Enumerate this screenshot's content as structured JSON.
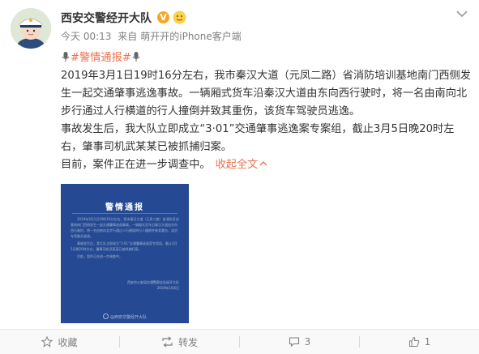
{
  "post": {
    "author": "西安交警经开大队",
    "timestamp": "今天 00:13",
    "source_prefix": "来自",
    "source_client": "萌开开的iPhone客户端",
    "hashtag": "#警情通报#",
    "paragraphs": [
      "2019年3月1日19时16分左右，我市秦汉大道（元凤二路）省消防培训基地南门西侧发生一起交通肇事逃逸事故。一辆厢式货车沿秦汉大道由东向西行驶时，将一名由南向北步行通过人行横道的行人撞倒并致其重伤，该货车驾驶员逃逸。",
      "事故发生后，我大队立即成立“3·01”交通肇事逃逸案专案组，截止3月5日晚20时左右，肇事司机武某某已被抓捕归案。",
      "目前，案件正在进一步调查中。"
    ],
    "collapse_label": "收起全文"
  },
  "notice_image": {
    "title": "警情通报",
    "body": [
      "2019年3月1日19时16分左右，我市秦汉大道（元凤二路）省消防培训基地南门西侧发生一起交通肇事逃逸事故。一辆厢式货车沿秦汉大道由东向西行驶时，将一名由南向北步行通过人行横道的行人撞倒并致其重伤，该货车驾驶员逃逸。",
      "事故发生后，我大队立即成立“3·01”交通肇事逃逸案专案组，截止3月5日晚20时左右，肇事司机武某某已被抓捕归案。",
      "目前，案件正在进一步调查中。"
    ],
    "signature": "西安市公安局交通警察支队经开大队",
    "date": "2019年3月6日",
    "watermark": "@西安交警经开大队"
  },
  "actions": {
    "favorite": "收藏",
    "repost": "转发",
    "comment_count": "3",
    "like_count": "1"
  },
  "colors": {
    "link": "#eb7350",
    "notice_bg": "#254a93",
    "verified": "#f5a623"
  }
}
